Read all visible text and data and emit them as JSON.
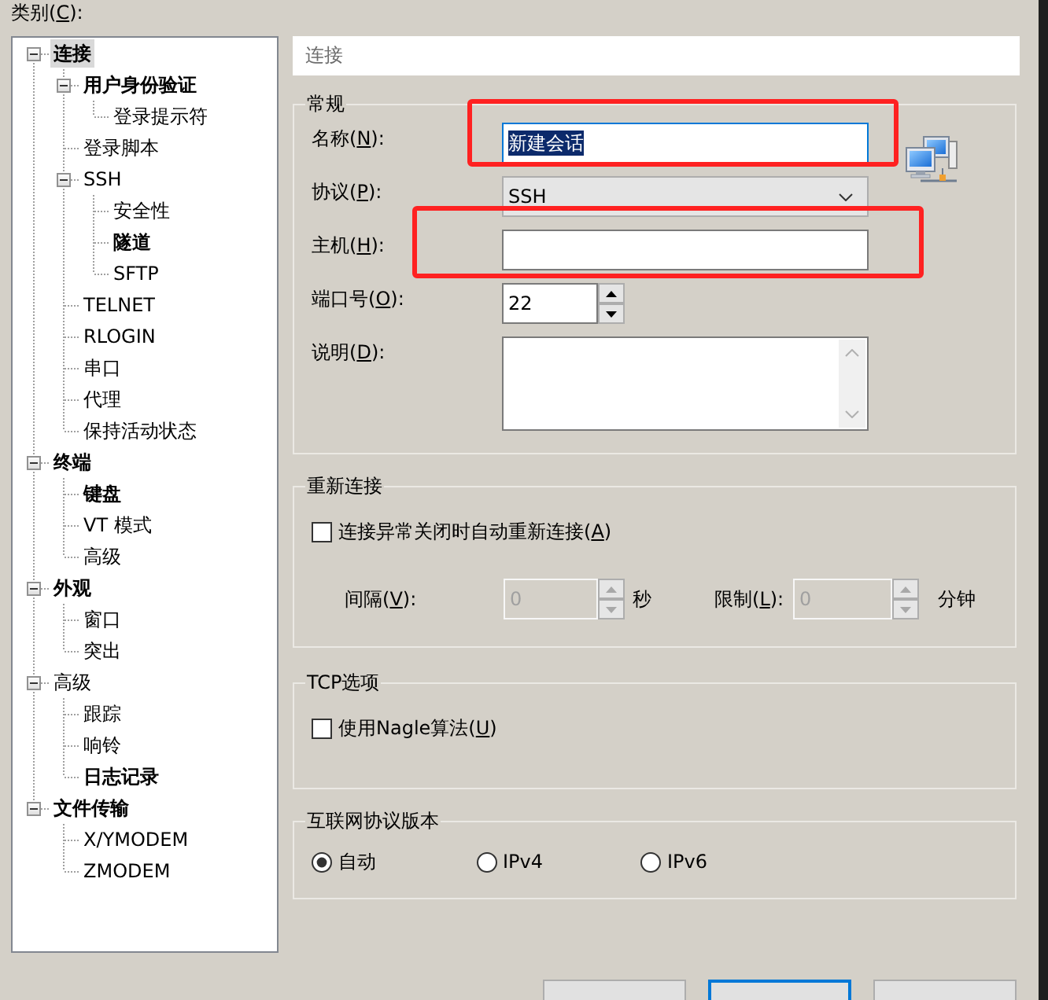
{
  "tree": {
    "label": {
      "before": "类别(",
      "key": "C",
      "after": "):"
    },
    "items": [
      {
        "label": "连接",
        "bold": true,
        "selected": true,
        "expanded": true,
        "children": [
          {
            "label": "用户身份验证",
            "bold": true,
            "selected": false,
            "expanded": true,
            "children": [
              {
                "label": "登录提示符",
                "bold": false,
                "selected": false
              }
            ]
          },
          {
            "label": "登录脚本",
            "bold": false,
            "selected": false
          },
          {
            "label": "SSH",
            "bold": false,
            "selected": false,
            "expanded": true,
            "children": [
              {
                "label": "安全性",
                "bold": false,
                "selected": false
              },
              {
                "label": "隧道",
                "bold": true,
                "selected": false
              },
              {
                "label": "SFTP",
                "bold": false,
                "selected": false
              }
            ]
          },
          {
            "label": "TELNET",
            "bold": false,
            "selected": false
          },
          {
            "label": "RLOGIN",
            "bold": false,
            "selected": false
          },
          {
            "label": "串口",
            "bold": false,
            "selected": false
          },
          {
            "label": "代理",
            "bold": false,
            "selected": false
          },
          {
            "label": "保持活动状态",
            "bold": false,
            "selected": false
          }
        ]
      },
      {
        "label": "终端",
        "bold": true,
        "selected": false,
        "expanded": true,
        "children": [
          {
            "label": "键盘",
            "bold": true,
            "selected": false
          },
          {
            "label": "VT 模式",
            "bold": false,
            "selected": false
          },
          {
            "label": "高级",
            "bold": false,
            "selected": false
          }
        ]
      },
      {
        "label": "外观",
        "bold": true,
        "selected": false,
        "expanded": true,
        "children": [
          {
            "label": "窗口",
            "bold": false,
            "selected": false
          },
          {
            "label": "突出",
            "bold": false,
            "selected": false
          }
        ]
      },
      {
        "label": "高级",
        "bold": false,
        "selected": false,
        "expanded": true,
        "children": [
          {
            "label": "跟踪",
            "bold": false,
            "selected": false
          },
          {
            "label": "响铃",
            "bold": false,
            "selected": false
          },
          {
            "label": "日志记录",
            "bold": true,
            "selected": false
          }
        ]
      },
      {
        "label": "文件传输",
        "bold": true,
        "selected": false,
        "expanded": true,
        "children": [
          {
            "label": "X/YMODEM",
            "bold": false,
            "selected": false
          },
          {
            "label": "ZMODEM",
            "bold": false,
            "selected": false
          }
        ]
      }
    ]
  },
  "page_header": {
    "title": "连接"
  },
  "general": {
    "title": "常规",
    "name": {
      "label": {
        "before": "名称(",
        "key": "N",
        "after": "):"
      },
      "value": "新建会话",
      "focused": true,
      "value_selected": true,
      "annotated": true
    },
    "protocol": {
      "label": {
        "before": "协议(",
        "key": "P",
        "after": "):"
      },
      "value": "SSH"
    },
    "host": {
      "label": {
        "before": "主机(",
        "key": "H",
        "after": "):"
      },
      "focused": false,
      "annotated": true
    },
    "port": {
      "label": {
        "before": "端口号(",
        "key": "O",
        "after": "):"
      },
      "value": "22",
      "disabled": false
    },
    "description": {
      "label": {
        "before": "说明(",
        "key": "D",
        "after": "):"
      }
    }
  },
  "reconnect": {
    "title": "重新连接",
    "auto_reconnect": {
      "label": {
        "before": "连接异常关闭时自动重新连接(",
        "key": "A",
        "after": ")"
      },
      "checked": false
    },
    "interval": {
      "label": {
        "before": "间隔(",
        "key": "V",
        "after": "):"
      },
      "value": "0",
      "disabled": true,
      "unit": "秒"
    },
    "limit": {
      "label": {
        "before": "限制(",
        "key": "L",
        "after": "):"
      },
      "value": "0",
      "disabled": true,
      "unit": "分钟"
    }
  },
  "tcp_options": {
    "title": "TCP选项",
    "nagle": {
      "label": {
        "before": "使用Nagle算法(",
        "key": "U",
        "after": ")"
      },
      "checked": false
    }
  },
  "ip_version": {
    "title": "互联网协议版本",
    "options": [
      {
        "label": "自动",
        "selected": true
      },
      {
        "label": "IPv4",
        "selected": false
      },
      {
        "label": "IPv6",
        "selected": false
      }
    ]
  },
  "dialog_buttons": [
    {
      "default": false
    },
    {
      "default": true
    },
    {
      "default": false
    }
  ]
}
